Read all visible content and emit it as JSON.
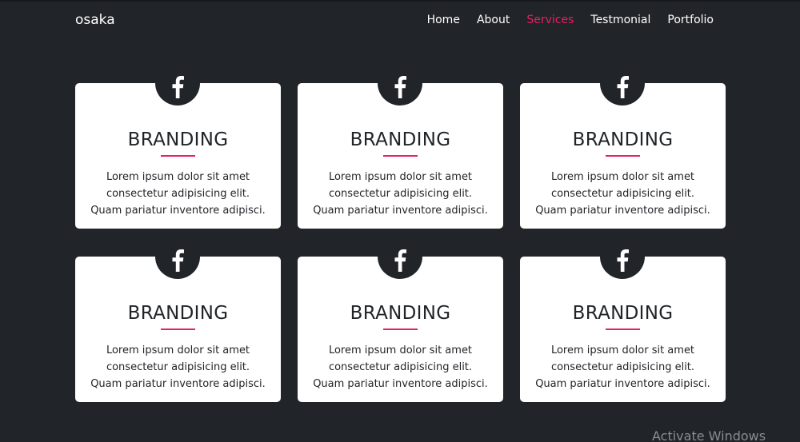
{
  "navbar": {
    "brand": "osaka",
    "links": [
      {
        "label": "Home",
        "active": false
      },
      {
        "label": "About",
        "active": false
      },
      {
        "label": "Services",
        "active": true
      },
      {
        "label": "Testmonial",
        "active": false
      },
      {
        "label": "Portfolio",
        "active": false
      }
    ]
  },
  "colors": {
    "background": "#212428",
    "accent": "#e91e63",
    "card": "#ffffff"
  },
  "services": [
    {
      "icon": "facebook-icon",
      "title": "BRANDING",
      "text": "Lorem ipsum dolor sit amet consectetur adipisicing elit. Quam pariatur inventore adipisci."
    },
    {
      "icon": "facebook-icon",
      "title": "BRANDING",
      "text": "Lorem ipsum dolor sit amet consectetur adipisicing elit. Quam pariatur inventore adipisci."
    },
    {
      "icon": "facebook-icon",
      "title": "BRANDING",
      "text": "Lorem ipsum dolor sit amet consectetur adipisicing elit. Quam pariatur inventore adipisci."
    },
    {
      "icon": "facebook-icon",
      "title": "BRANDING",
      "text": "Lorem ipsum dolor sit amet consectetur adipisicing elit. Quam pariatur inventore adipisci."
    },
    {
      "icon": "facebook-icon",
      "title": "BRANDING",
      "text": "Lorem ipsum dolor sit amet consectetur adipisicing elit. Quam pariatur inventore adipisci."
    },
    {
      "icon": "facebook-icon",
      "title": "BRANDING",
      "text": "Lorem ipsum dolor sit amet consectetur adipisicing elit. Quam pariatur inventore adipisci."
    }
  ],
  "watermark": "Activate Windows"
}
